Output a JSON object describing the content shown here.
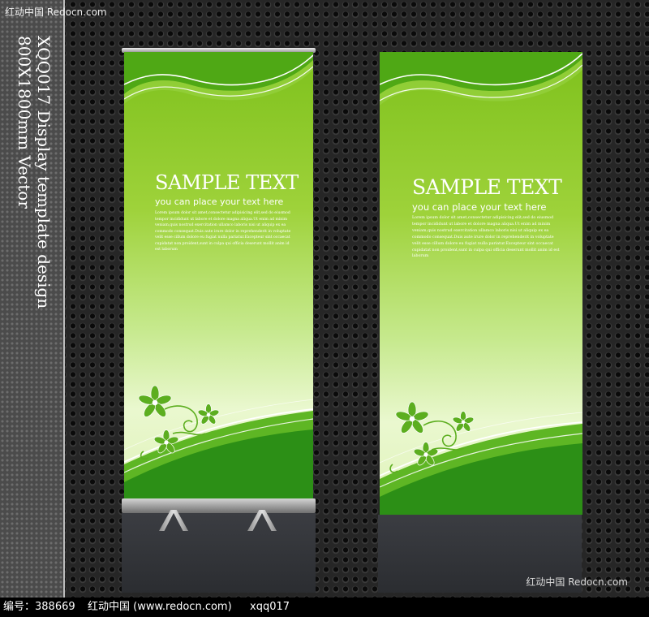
{
  "watermark_top": "红动中国 Redocn.com",
  "watermark_bottom": "红动中国 Redocn.com",
  "vertical_caption": {
    "line1": "XQQ017 Display template design",
    "line2": "800X1800mm Vector"
  },
  "banners": [
    {
      "title": "SAMPLE TEXT",
      "subtitle": "you can place your text here",
      "body": "Lorem ipsum dolor sit amet,consectetur adipisicing elit,sed do eiusmod tempor incididunt ut labore et dolore magna aliqua.Ut enim ad minim veniam,quis nostrud exercitation ullamco laboris nisi ut aliquip ex ea commodo consequat.Duis aute irure dolor in reprehenderit in voluptate velit esse cillum dolore eu fugiat nulla pariatur.Excepteur sint occaecat cupidatat non proident,sunt in culpa qui officia deserunt mollit anim id est laborum"
    },
    {
      "title": "SAMPLE TEXT",
      "subtitle": "you can place your text here",
      "body": "Lorem ipsum dolor sit amet,consectetur adipisicing elit,sed do eiusmod tempor incididunt ut labore et dolore magna aliqua.Ut enim ad minim veniam,quis nostrud exercitation ullamco laboris nisi ut aliquip ex ea commodo consequat.Duis aute irure dolor in reprehenderit in voluptate velit esse cillum dolore eu fugiat nulla pariatur.Excepteur sint occaecat cupidatat non proident,sunt in culpa qui officia deserunt mollit anim id est laborum"
    }
  ],
  "footer": {
    "id_label": "编号：388669",
    "site": "红动中国 (www.redocn.com)",
    "code": "xqq017"
  },
  "colors": {
    "banner_green_dark": "#3d9a10",
    "banner_green": "#7ec11c",
    "banner_light": "#eaf8cf",
    "background": "#262626"
  },
  "icons": [
    "flower-icon",
    "leaf-swirl-icon"
  ]
}
